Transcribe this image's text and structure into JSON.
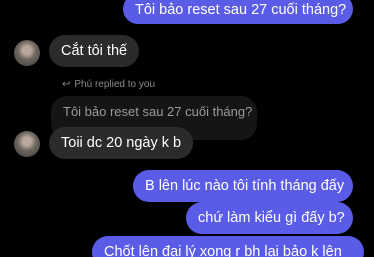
{
  "messages": {
    "m1": "Tôi bảo reset sau 27 cuối tháng?",
    "m2": "Cắt tôi thế",
    "reply_label": "Phú replied to you",
    "quoted": "Tôi bảo reset sau 27 cuối tháng?",
    "m3": "Toii dc 20 ngày k b",
    "m4": "B lên lúc nào tôi tính tháng đấy",
    "m5": "chứ làm kiểu gì đấy b?",
    "m6": "Chốt lên đại lý xong r bh lại bảo k lên"
  },
  "colors": {
    "outgoing": "#5a5ce8",
    "incoming": "#2b2b2e",
    "background": "#000000"
  },
  "icons": {
    "reply": "reply-arrow-icon",
    "avatar": "avatar"
  }
}
